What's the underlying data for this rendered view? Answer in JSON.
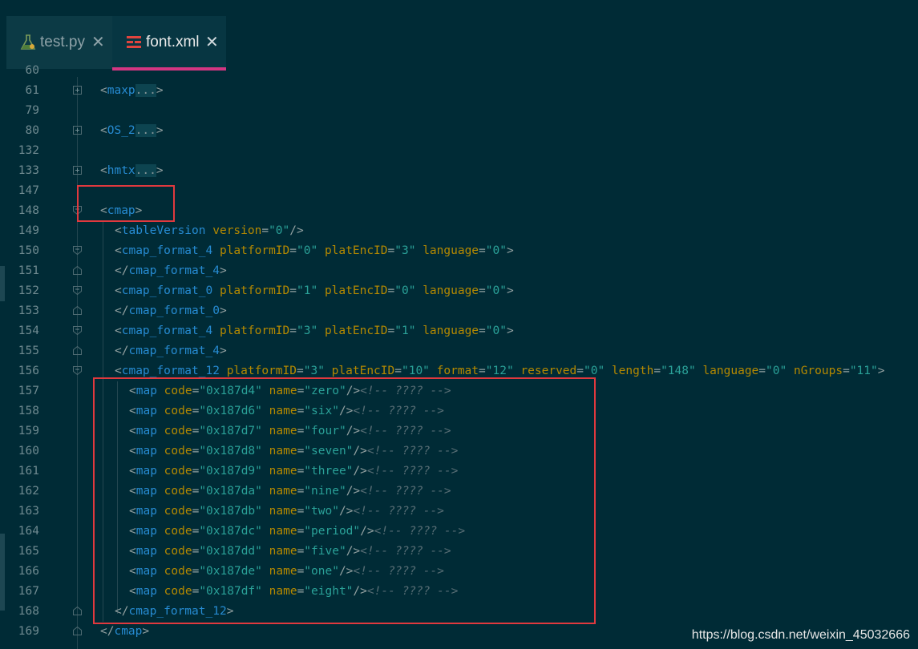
{
  "tabs": [
    {
      "label": "test.py",
      "icon": "flask-icon",
      "active": false
    },
    {
      "label": "font.xml",
      "icon": "xml-file-icon",
      "active": true
    }
  ],
  "colors": {
    "background": "#002b36",
    "tag": "#268bd2",
    "attribute": "#b58900",
    "value": "#2aa198",
    "comment": "#586e75",
    "active_tab_underline": "#d33682",
    "highlight_box": "#e0393e"
  },
  "lines": [
    {
      "num": "60",
      "tokens": []
    },
    {
      "num": "61",
      "tokens": [
        [
          "punc",
          "<"
        ],
        [
          "tag",
          "maxp"
        ],
        [
          "coll",
          "..."
        ],
        [
          "punc",
          ">"
        ]
      ]
    },
    {
      "num": "79",
      "tokens": []
    },
    {
      "num": "80",
      "tokens": [
        [
          "punc",
          "<"
        ],
        [
          "tag",
          "OS_2"
        ],
        [
          "coll",
          "..."
        ],
        [
          "punc",
          ">"
        ]
      ]
    },
    {
      "num": "132",
      "tokens": []
    },
    {
      "num": "133",
      "tokens": [
        [
          "punc",
          "<"
        ],
        [
          "tag",
          "hmtx"
        ],
        [
          "coll",
          "..."
        ],
        [
          "punc",
          ">"
        ]
      ]
    },
    {
      "num": "147",
      "tokens": []
    },
    {
      "num": "148",
      "tokens": [
        [
          "punc",
          "<"
        ],
        [
          "tag",
          "cmap"
        ],
        [
          "punc",
          ">"
        ]
      ]
    },
    {
      "num": "149",
      "tokens": [
        [
          "punc",
          "<"
        ],
        [
          "tag",
          "tableVersion"
        ],
        [
          "txt",
          " "
        ],
        [
          "attr",
          "version"
        ],
        [
          "punc",
          "="
        ],
        [
          "val",
          "\"0\""
        ],
        [
          "punc",
          "/>"
        ]
      ]
    },
    {
      "num": "150",
      "tokens": [
        [
          "punc",
          "<"
        ],
        [
          "tag",
          "cmap_format_4"
        ],
        [
          "txt",
          " "
        ],
        [
          "attr",
          "platformID"
        ],
        [
          "punc",
          "="
        ],
        [
          "val",
          "\"0\""
        ],
        [
          "txt",
          " "
        ],
        [
          "attr",
          "platEncID"
        ],
        [
          "punc",
          "="
        ],
        [
          "val",
          "\"3\""
        ],
        [
          "txt",
          " "
        ],
        [
          "attr",
          "language"
        ],
        [
          "punc",
          "="
        ],
        [
          "val",
          "\"0\""
        ],
        [
          "punc",
          ">"
        ]
      ]
    },
    {
      "num": "151",
      "tokens": [
        [
          "punc",
          "</"
        ],
        [
          "tag",
          "cmap_format_4"
        ],
        [
          "punc",
          ">"
        ]
      ]
    },
    {
      "num": "152",
      "tokens": [
        [
          "punc",
          "<"
        ],
        [
          "tag",
          "cmap_format_0"
        ],
        [
          "txt",
          " "
        ],
        [
          "attr",
          "platformID"
        ],
        [
          "punc",
          "="
        ],
        [
          "val",
          "\"1\""
        ],
        [
          "txt",
          " "
        ],
        [
          "attr",
          "platEncID"
        ],
        [
          "punc",
          "="
        ],
        [
          "val",
          "\"0\""
        ],
        [
          "txt",
          " "
        ],
        [
          "attr",
          "language"
        ],
        [
          "punc",
          "="
        ],
        [
          "val",
          "\"0\""
        ],
        [
          "punc",
          ">"
        ]
      ]
    },
    {
      "num": "153",
      "tokens": [
        [
          "punc",
          "</"
        ],
        [
          "tag",
          "cmap_format_0"
        ],
        [
          "punc",
          ">"
        ]
      ]
    },
    {
      "num": "154",
      "tokens": [
        [
          "punc",
          "<"
        ],
        [
          "tag",
          "cmap_format_4"
        ],
        [
          "txt",
          " "
        ],
        [
          "attr",
          "platformID"
        ],
        [
          "punc",
          "="
        ],
        [
          "val",
          "\"3\""
        ],
        [
          "txt",
          " "
        ],
        [
          "attr",
          "platEncID"
        ],
        [
          "punc",
          "="
        ],
        [
          "val",
          "\"1\""
        ],
        [
          "txt",
          " "
        ],
        [
          "attr",
          "language"
        ],
        [
          "punc",
          "="
        ],
        [
          "val",
          "\"0\""
        ],
        [
          "punc",
          ">"
        ]
      ]
    },
    {
      "num": "155",
      "tokens": [
        [
          "punc",
          "</"
        ],
        [
          "tag",
          "cmap_format_4"
        ],
        [
          "punc",
          ">"
        ]
      ]
    },
    {
      "num": "156",
      "tokens": [
        [
          "punc",
          "<"
        ],
        [
          "tag",
          "cmap_format_12"
        ],
        [
          "txt",
          " "
        ],
        [
          "attr",
          "platformID"
        ],
        [
          "punc",
          "="
        ],
        [
          "val",
          "\"3\""
        ],
        [
          "txt",
          " "
        ],
        [
          "attr",
          "platEncID"
        ],
        [
          "punc",
          "="
        ],
        [
          "val",
          "\"10\""
        ],
        [
          "txt",
          " "
        ],
        [
          "attr",
          "format"
        ],
        [
          "punc",
          "="
        ],
        [
          "val",
          "\"12\""
        ],
        [
          "txt",
          " "
        ],
        [
          "attr",
          "reserved"
        ],
        [
          "punc",
          "="
        ],
        [
          "val",
          "\"0\""
        ],
        [
          "txt",
          " "
        ],
        [
          "attr",
          "length"
        ],
        [
          "punc",
          "="
        ],
        [
          "val",
          "\"148\""
        ],
        [
          "txt",
          " "
        ],
        [
          "attr",
          "language"
        ],
        [
          "punc",
          "="
        ],
        [
          "val",
          "\"0\""
        ],
        [
          "txt",
          " "
        ],
        [
          "attr",
          "nGroups"
        ],
        [
          "punc",
          "="
        ],
        [
          "val",
          "\"11\""
        ],
        [
          "punc",
          ">"
        ]
      ]
    },
    {
      "num": "157",
      "tokens": [
        [
          "punc",
          "<"
        ],
        [
          "tag",
          "map"
        ],
        [
          "txt",
          " "
        ],
        [
          "attr",
          "code"
        ],
        [
          "punc",
          "="
        ],
        [
          "val",
          "\"0x187d4\""
        ],
        [
          "txt",
          " "
        ],
        [
          "attr",
          "name"
        ],
        [
          "punc",
          "="
        ],
        [
          "val",
          "\"zero\""
        ],
        [
          "punc",
          "/>"
        ],
        [
          "cmt",
          "<!-- ???? -->"
        ]
      ]
    },
    {
      "num": "158",
      "tokens": [
        [
          "punc",
          "<"
        ],
        [
          "tag",
          "map"
        ],
        [
          "txt",
          " "
        ],
        [
          "attr",
          "code"
        ],
        [
          "punc",
          "="
        ],
        [
          "val",
          "\"0x187d6\""
        ],
        [
          "txt",
          " "
        ],
        [
          "attr",
          "name"
        ],
        [
          "punc",
          "="
        ],
        [
          "val",
          "\"six\""
        ],
        [
          "punc",
          "/>"
        ],
        [
          "cmt",
          "<!-- ???? -->"
        ]
      ]
    },
    {
      "num": "159",
      "tokens": [
        [
          "punc",
          "<"
        ],
        [
          "tag",
          "map"
        ],
        [
          "txt",
          " "
        ],
        [
          "attr",
          "code"
        ],
        [
          "punc",
          "="
        ],
        [
          "val",
          "\"0x187d7\""
        ],
        [
          "txt",
          " "
        ],
        [
          "attr",
          "name"
        ],
        [
          "punc",
          "="
        ],
        [
          "val",
          "\"four\""
        ],
        [
          "punc",
          "/>"
        ],
        [
          "cmt",
          "<!-- ???? -->"
        ]
      ]
    },
    {
      "num": "160",
      "tokens": [
        [
          "punc",
          "<"
        ],
        [
          "tag",
          "map"
        ],
        [
          "txt",
          " "
        ],
        [
          "attr",
          "code"
        ],
        [
          "punc",
          "="
        ],
        [
          "val",
          "\"0x187d8\""
        ],
        [
          "txt",
          " "
        ],
        [
          "attr",
          "name"
        ],
        [
          "punc",
          "="
        ],
        [
          "val",
          "\"seven\""
        ],
        [
          "punc",
          "/>"
        ],
        [
          "cmt",
          "<!-- ???? -->"
        ]
      ]
    },
    {
      "num": "161",
      "tokens": [
        [
          "punc",
          "<"
        ],
        [
          "tag",
          "map"
        ],
        [
          "txt",
          " "
        ],
        [
          "attr",
          "code"
        ],
        [
          "punc",
          "="
        ],
        [
          "val",
          "\"0x187d9\""
        ],
        [
          "txt",
          " "
        ],
        [
          "attr",
          "name"
        ],
        [
          "punc",
          "="
        ],
        [
          "val",
          "\"three\""
        ],
        [
          "punc",
          "/>"
        ],
        [
          "cmt",
          "<!-- ???? -->"
        ]
      ]
    },
    {
      "num": "162",
      "tokens": [
        [
          "punc",
          "<"
        ],
        [
          "tag",
          "map"
        ],
        [
          "txt",
          " "
        ],
        [
          "attr",
          "code"
        ],
        [
          "punc",
          "="
        ],
        [
          "val",
          "\"0x187da\""
        ],
        [
          "txt",
          " "
        ],
        [
          "attr",
          "name"
        ],
        [
          "punc",
          "="
        ],
        [
          "val",
          "\"nine\""
        ],
        [
          "punc",
          "/>"
        ],
        [
          "cmt",
          "<!-- ???? -->"
        ]
      ]
    },
    {
      "num": "163",
      "tokens": [
        [
          "punc",
          "<"
        ],
        [
          "tag",
          "map"
        ],
        [
          "txt",
          " "
        ],
        [
          "attr",
          "code"
        ],
        [
          "punc",
          "="
        ],
        [
          "val",
          "\"0x187db\""
        ],
        [
          "txt",
          " "
        ],
        [
          "attr",
          "name"
        ],
        [
          "punc",
          "="
        ],
        [
          "val",
          "\"two\""
        ],
        [
          "punc",
          "/>"
        ],
        [
          "cmt",
          "<!-- ???? -->"
        ]
      ]
    },
    {
      "num": "164",
      "tokens": [
        [
          "punc",
          "<"
        ],
        [
          "tag",
          "map"
        ],
        [
          "txt",
          " "
        ],
        [
          "attr",
          "code"
        ],
        [
          "punc",
          "="
        ],
        [
          "val",
          "\"0x187dc\""
        ],
        [
          "txt",
          " "
        ],
        [
          "attr",
          "name"
        ],
        [
          "punc",
          "="
        ],
        [
          "val",
          "\"period\""
        ],
        [
          "punc",
          "/>"
        ],
        [
          "cmt",
          "<!-- ???? -->"
        ]
      ]
    },
    {
      "num": "165",
      "tokens": [
        [
          "punc",
          "<"
        ],
        [
          "tag",
          "map"
        ],
        [
          "txt",
          " "
        ],
        [
          "attr",
          "code"
        ],
        [
          "punc",
          "="
        ],
        [
          "val",
          "\"0x187dd\""
        ],
        [
          "txt",
          " "
        ],
        [
          "attr",
          "name"
        ],
        [
          "punc",
          "="
        ],
        [
          "val",
          "\"five\""
        ],
        [
          "punc",
          "/>"
        ],
        [
          "cmt",
          "<!-- ???? -->"
        ]
      ]
    },
    {
      "num": "166",
      "tokens": [
        [
          "punc",
          "<"
        ],
        [
          "tag",
          "map"
        ],
        [
          "txt",
          " "
        ],
        [
          "attr",
          "code"
        ],
        [
          "punc",
          "="
        ],
        [
          "val",
          "\"0x187de\""
        ],
        [
          "txt",
          " "
        ],
        [
          "attr",
          "name"
        ],
        [
          "punc",
          "="
        ],
        [
          "val",
          "\"one\""
        ],
        [
          "punc",
          "/>"
        ],
        [
          "cmt",
          "<!-- ???? -->"
        ]
      ]
    },
    {
      "num": "167",
      "tokens": [
        [
          "punc",
          "<"
        ],
        [
          "tag",
          "map"
        ],
        [
          "txt",
          " "
        ],
        [
          "attr",
          "code"
        ],
        [
          "punc",
          "="
        ],
        [
          "val",
          "\"0x187df\""
        ],
        [
          "txt",
          " "
        ],
        [
          "attr",
          "name"
        ],
        [
          "punc",
          "="
        ],
        [
          "val",
          "\"eight\""
        ],
        [
          "punc",
          "/>"
        ],
        [
          "cmt",
          "<!-- ???? -->"
        ]
      ]
    },
    {
      "num": "168",
      "tokens": [
        [
          "punc",
          "</"
        ],
        [
          "tag",
          "cmap_format_12"
        ],
        [
          "punc",
          ">"
        ]
      ]
    },
    {
      "num": "169",
      "tokens": [
        [
          "punc",
          "</"
        ],
        [
          "tag",
          "cmap"
        ],
        [
          "punc",
          ">"
        ]
      ]
    }
  ],
  "watermark": "https://blog.csdn.net/weixin_45032666"
}
